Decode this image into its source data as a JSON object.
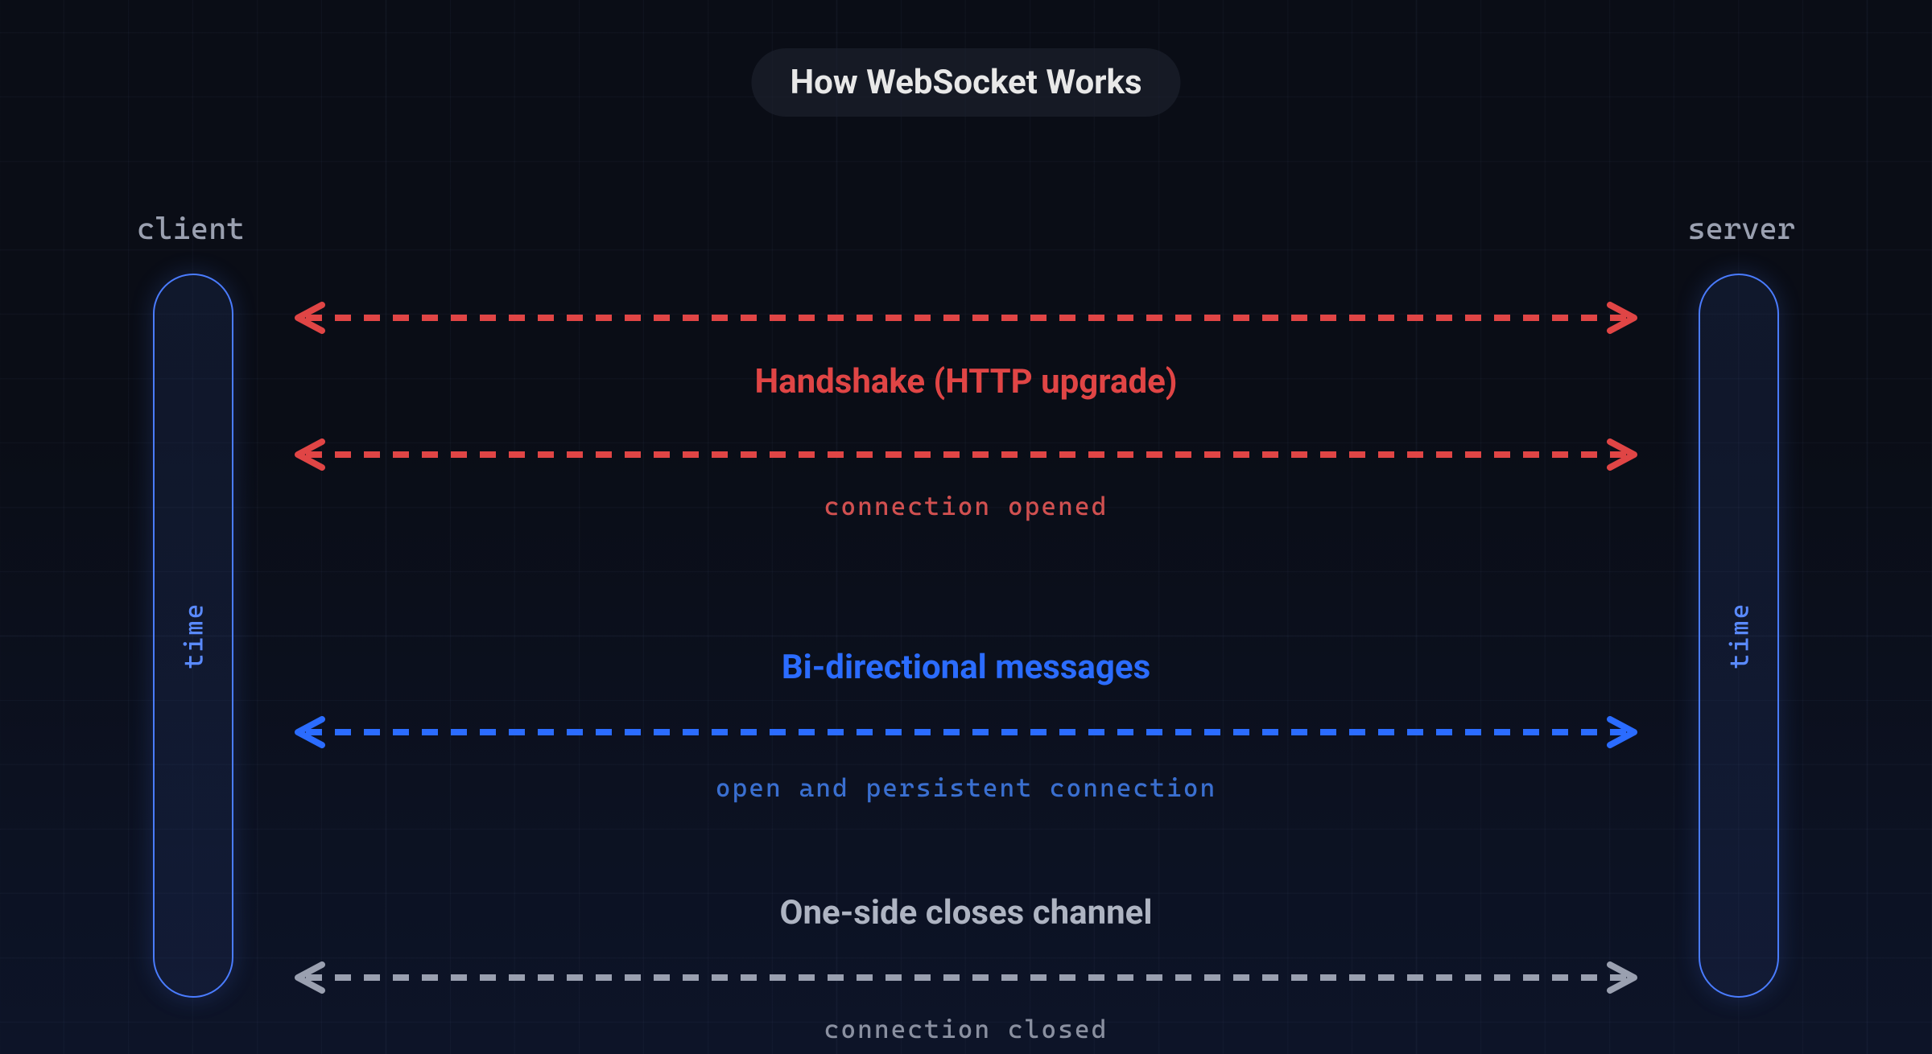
{
  "title": "How WebSocket Works",
  "endpoints": {
    "client": "client",
    "server": "server"
  },
  "timeline_label": "time",
  "phases": {
    "handshake": {
      "title": "Handshake (HTTP upgrade)",
      "subtitle": "connection opened",
      "color": "#e04545"
    },
    "bidirectional": {
      "title": "Bi-directional messages",
      "subtitle": "open and persistent connection",
      "color": "#2b6cff"
    },
    "close": {
      "title": "One-side closes channel",
      "subtitle": "connection closed",
      "color": "#9aa0b0"
    }
  }
}
